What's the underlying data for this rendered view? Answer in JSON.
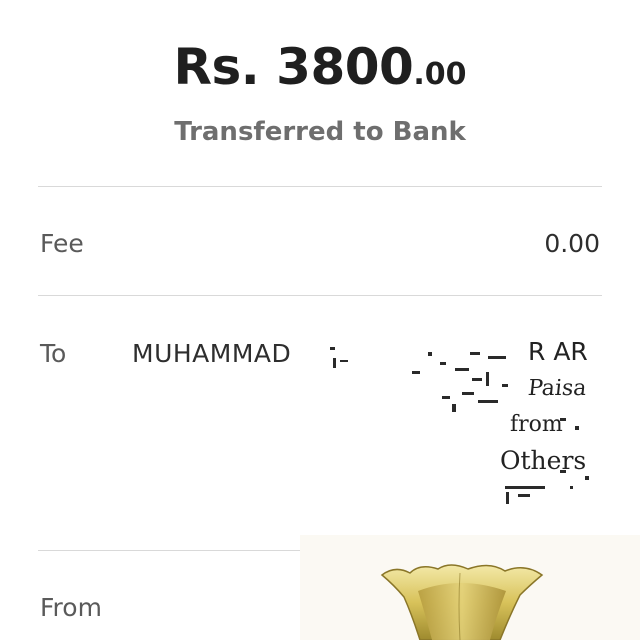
{
  "amount": {
    "main": "Rs. 3800",
    "decimal": ".00"
  },
  "status_text": "Transferred to Bank",
  "rows": {
    "fee": {
      "label": "Fee",
      "value": "0.00"
    },
    "to": {
      "label": "To",
      "name": "MUHAMMAD",
      "obscured_fragments": [
        "R AR",
        "Paisa",
        "from",
        "Others"
      ]
    },
    "from": {
      "label": "From"
    }
  },
  "sticker": {
    "icon": "tulip-icon",
    "colors": [
      "#d8c25a",
      "#9e8a2e",
      "#f3e9a8"
    ]
  },
  "colors": {
    "amount_text": "#1f1f1f",
    "subtitle_text": "#6e6e6e",
    "label_text": "#5a5a5a",
    "divider": "#d9d9d9"
  }
}
